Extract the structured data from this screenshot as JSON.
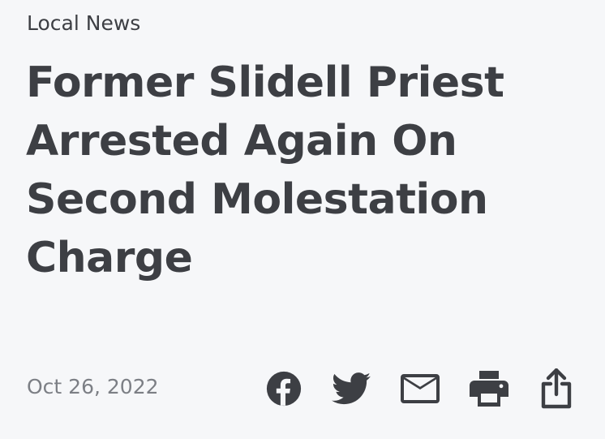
{
  "article": {
    "category": "Local News",
    "headline": "Former Slidell Priest Arrested Again On Second Molestation Charge",
    "date": "Oct 26, 2022"
  },
  "share_icons": [
    "facebook-icon",
    "twitter-icon",
    "email-icon",
    "print-icon",
    "share-icon"
  ],
  "colors": {
    "background": "#f6f7f9",
    "text": "#3d3f44",
    "muted": "#7c7f85"
  }
}
